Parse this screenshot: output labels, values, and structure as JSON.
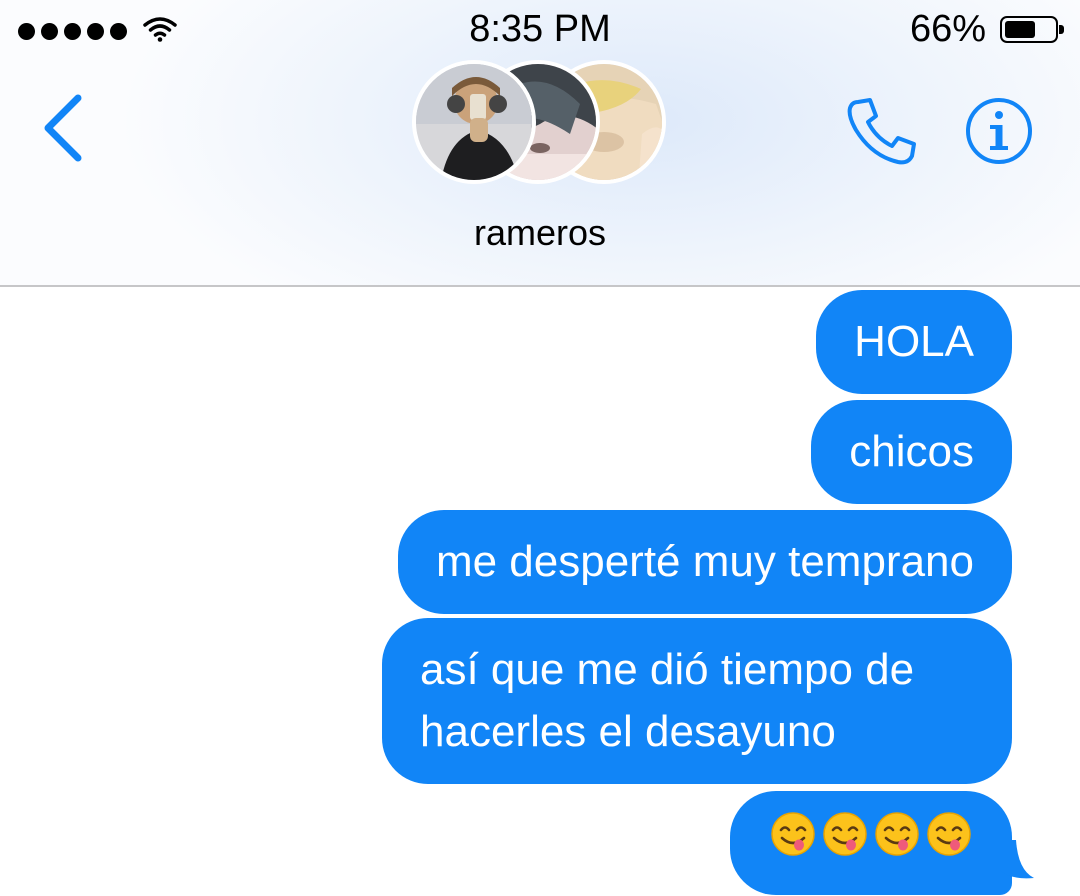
{
  "status_bar": {
    "time": "8:35 PM",
    "battery": "66%",
    "battery_level": 0.66,
    "signal_bars": 5,
    "wifi_icon": "wifi-icon"
  },
  "header": {
    "back_icon": "chevron-left-icon",
    "group_name": "rameros",
    "call_icon": "phone-icon",
    "info_icon": "info-icon",
    "avatar_count": 3
  },
  "messages": [
    {
      "text": "HOLA",
      "sender": "me"
    },
    {
      "text": "chicos",
      "sender": "me"
    },
    {
      "text": "me desperté muy temprano",
      "sender": "me"
    },
    {
      "text": "así que me dió tiempo de hacerles el desayuno",
      "sender": "me"
    },
    {
      "text": "😋😋😋😋",
      "sender": "me",
      "emoji_count": 4,
      "emoji_name": "face-savoring-food"
    }
  ],
  "colors": {
    "accent": "#1185f7",
    "bubble": "#1185f7",
    "bubble_text": "#ffffff",
    "divider": "#c6c6c8"
  }
}
